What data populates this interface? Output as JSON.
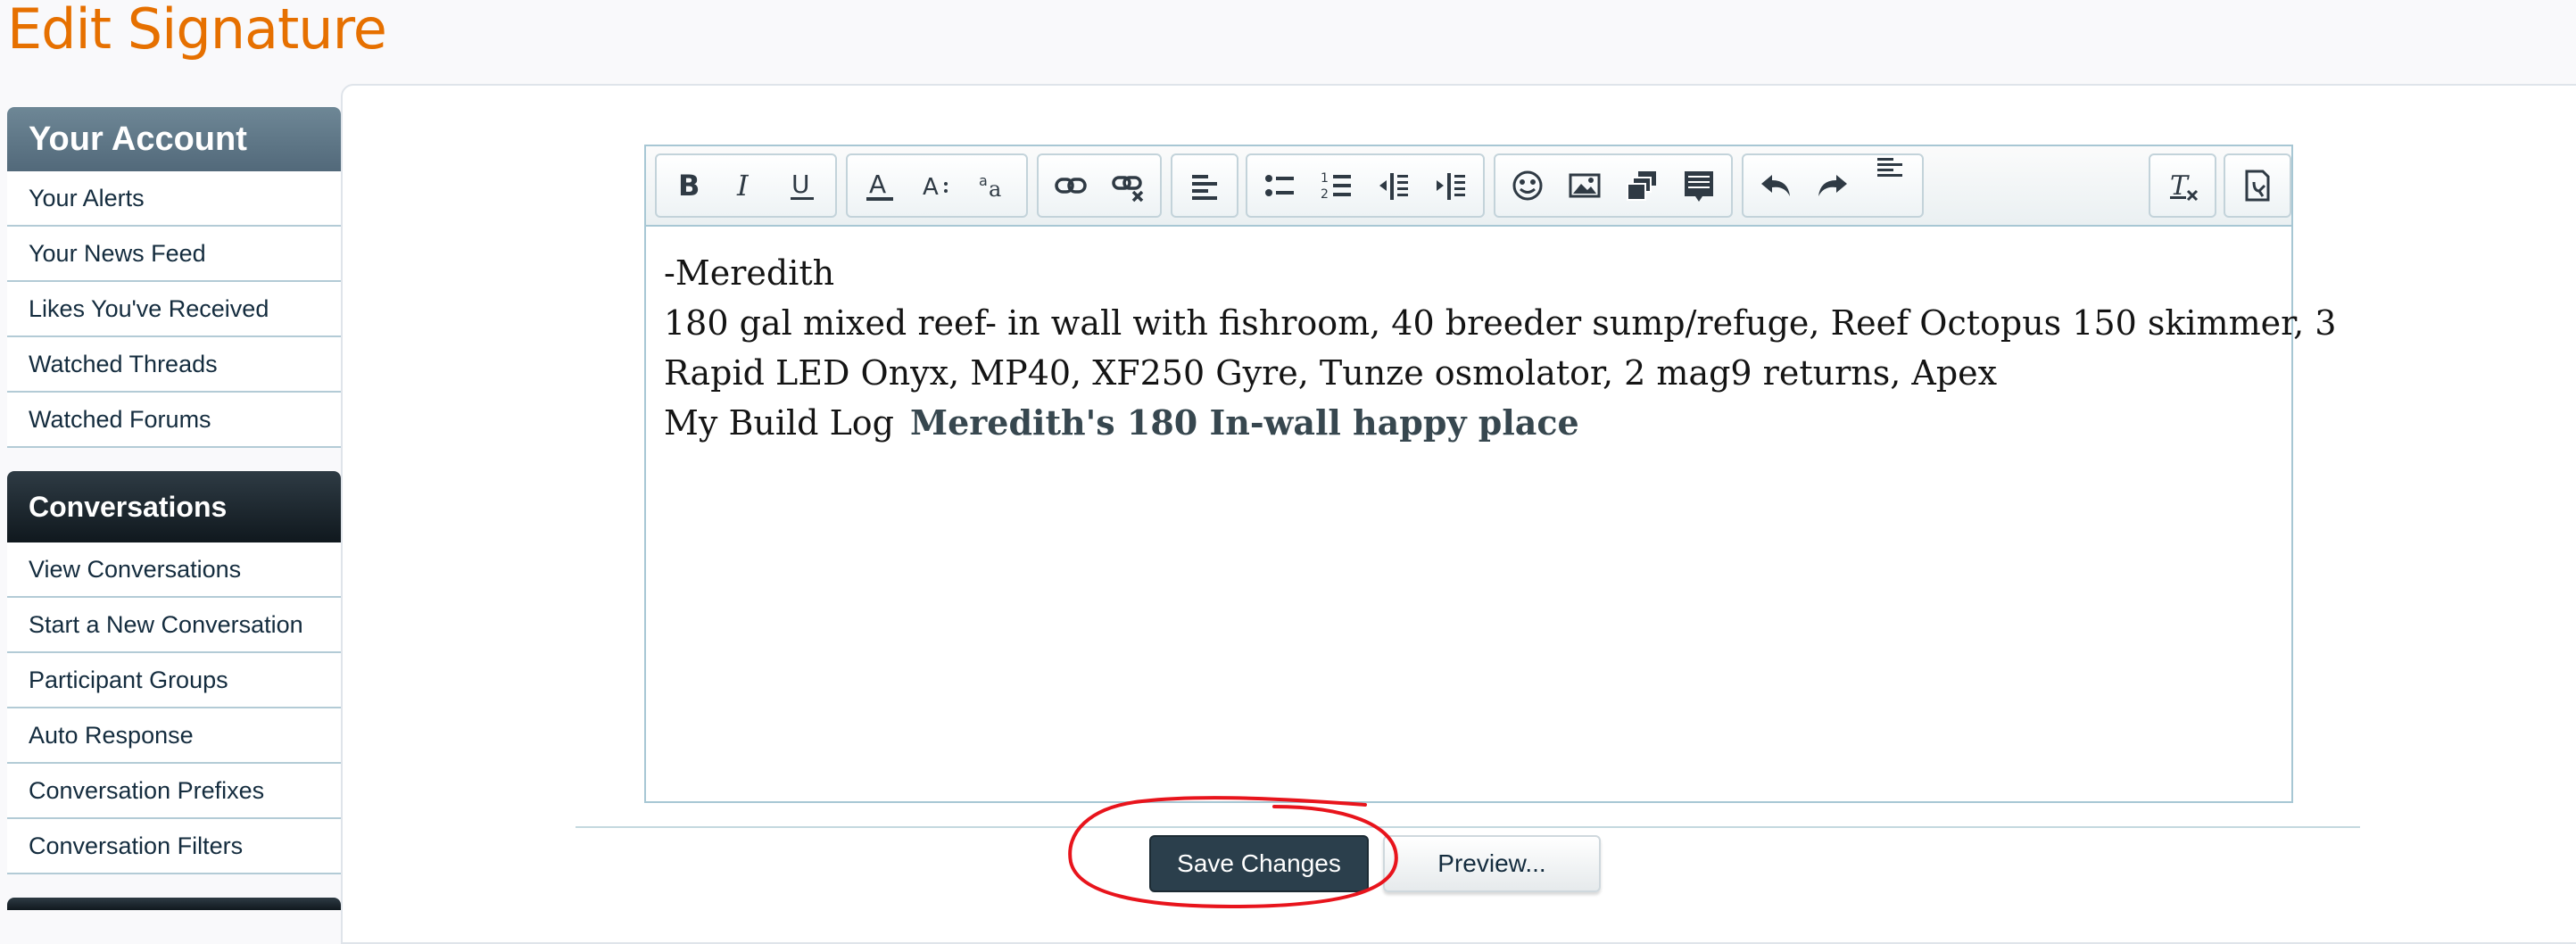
{
  "page": {
    "title": "Edit Signature"
  },
  "sidebar": {
    "account_heading": "Your Account",
    "account_items": [
      {
        "label": "Your Alerts"
      },
      {
        "label": "Your News Feed"
      },
      {
        "label": "Likes You've Received"
      },
      {
        "label": "Watched Threads"
      },
      {
        "label": "Watched Forums"
      }
    ],
    "conversations_heading": "Conversations",
    "conversation_items": [
      {
        "label": "View Conversations"
      },
      {
        "label": "Start a New Conversation"
      },
      {
        "label": "Participant Groups"
      },
      {
        "label": "Auto Response"
      },
      {
        "label": "Conversation Prefixes"
      },
      {
        "label": "Conversation Filters"
      }
    ]
  },
  "editor": {
    "toolbar_icons": [
      "bold-icon",
      "italic-icon",
      "underline-icon",
      "text-color-icon",
      "font-size-icon",
      "font-family-icon",
      "link-icon",
      "unlink-icon",
      "align-left-icon",
      "bullet-list-icon",
      "numbered-list-icon",
      "outdent-icon",
      "indent-icon",
      "smilies-icon",
      "image-icon",
      "media-icon",
      "insert-block-icon",
      "undo-icon",
      "redo-icon",
      "align-dropdown-icon",
      "remove-format-icon",
      "toggle-bbcode-icon"
    ],
    "content": {
      "line1": "-Meredith",
      "line2": "180 gal mixed reef- in wall with fishroom, 40 breeder sump/refuge, Reef Octopus 150 skimmer, 3",
      "line3": "Rapid LED Onyx, MP40, XF250 Gyre, Tunze osmolator, 2 mag9 returns, Apex",
      "line4_prefix": "My Build Log",
      "line4_link": "Meredith's 180 In-wall happy place"
    }
  },
  "buttons": {
    "save": "Save Changes",
    "preview": "Preview..."
  },
  "colors": {
    "title": "#e67000",
    "annotation": "#e8141c",
    "primary_button": "#2b3f4c"
  }
}
